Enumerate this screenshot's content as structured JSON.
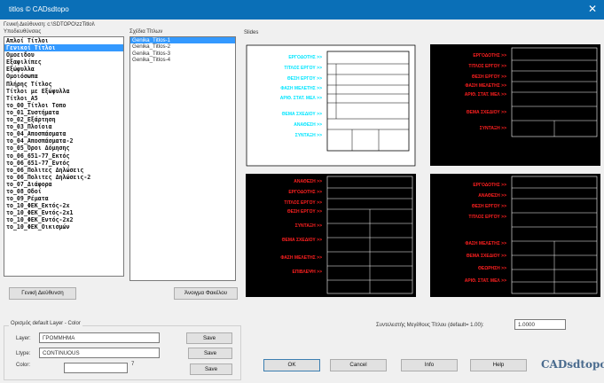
{
  "window": {
    "title": "titlos  © CADsdtopo",
    "close_glyph": "✕"
  },
  "path": {
    "label": "Γενική Διεύθυνση: c:\\SDTOPO\\zzTitloi\\"
  },
  "folders": {
    "label": "Υποδιευθύνσεις",
    "items": [
      "Απλοί Τίτλοι",
      "Γενικοί Τίτλοι",
      "Ομοειδου",
      "Εξαφιλίπες",
      "Εξώφυλλα",
      "Ομοιόσωπα",
      "Πλήρης Τίτλος",
      "Τίτλοι με Εξώφυλλα",
      "Τίτλοι_Α5",
      "το_00_Τίτλοι Τοπο",
      "το_01_Συστήματα",
      "το_02_Εξάρτηση",
      "το_03_Πλοίοια",
      "το_04_Αποσπάσματα",
      "το_04_Αποσπάσματα-2",
      "το_05_Όροι Δόμησης",
      "το_06_651-77_Εκτός",
      "το_06_651-77_Εντός",
      "το_06_Πολιτες Δηλώσεις",
      "το_06_Πολιτες Δηλώσεις-2",
      "το_07_Διάφορα",
      "το_08_Οδοί",
      "το_09_Ρέματα",
      "το_10_ΦΕΚ_Εκτός-2x",
      "το_10_ΦΕΚ_Εντός-2x1",
      "το_10_ΦΕΚ_Εντός-2x2",
      "το_10_ΦΕΚ_Οικισμών"
    ],
    "selected_index": 1
  },
  "templates": {
    "label": "Σχέδια Τίτλων",
    "items": [
      "Genika_Titlos-1",
      "Genika_Titlos-2",
      "Genika_Titlos-3",
      "Genika_Titlos-4"
    ],
    "selected_index": 0
  },
  "slides": {
    "label": "Slides"
  },
  "buttons": {
    "general_address": "Γενική Διεύθυνση",
    "open_folder": "Άνοιγμα Φακέλου",
    "save1": "Save",
    "save2": "Save",
    "save3": "Save",
    "ok": "OK",
    "cancel": "Cancel",
    "info": "Info",
    "help": "Help"
  },
  "defaults_group": {
    "label": "Ορισμός default Layer - Color",
    "layer_label": "Layer:",
    "layer_value": "ΓΡΟΜΜΗΜΑ",
    "ltype_label": "Ltype:",
    "ltype_value": "CONTINUOUS",
    "color_label": "Color:",
    "color_value": "",
    "color_hint": "7"
  },
  "scale": {
    "label": "Συντελεστής Μεγέθους Τίτλου (default= 1.00):",
    "value": "1.0000"
  },
  "logo": {
    "text": "CADsdtopo"
  },
  "slide_text": {
    "s1": {
      "labels": [
        "ΕΡΓΟΔΟΤΗΣ >>",
        "ΤΙΤΛΟΣ ΕΡΓΟΥ >>",
        "ΘΕΣΗ ΕΡΓΟΥ >>",
        "ΦΑΣΗ ΜΕΛΕΤΗΣ >>",
        "ΑΡΙΘ. ΣΤΑΤ. ΜΕΛ >>",
        "ΘΕΜΑ ΣΧΕΔΙΟΥ >>",
        "ΑΝΑΘΕΣΗ >>",
        "ΣΥΝΤΑΞΗ >>"
      ]
    },
    "s2": {
      "labels": [
        "ΕΡΓΟΔΟΤΗΣ >>",
        "ΤΙΤΛΟΣ ΕΡΓΟΥ >>",
        "ΘΕΣΗ ΕΡΓΟΥ >>",
        "ΦΑΣΗ ΜΕΛΕΤΗΣ >>",
        "ΑΡΙΘ. ΣΤΑΤ. ΜΕΛ >>",
        "ΘΕΜΑ ΣΧΕΔΙΟΥ >>",
        "ΣΥΝΤΑΞΗ >>"
      ]
    },
    "s3": {
      "labels": [
        "ΑΝΑΘΕΣΗ >>",
        "ΕΡΓΟΔΟΤΗΣ >>",
        "ΤΙΤΛΟΣ ΕΡΓΟΥ >>",
        "ΘΕΣΗ ΕΡΓΟΥ >>",
        "ΣΥΝΤΑΞΗ >>",
        "ΘΕΜΑ ΣΧΕΔΙΟΥ >>",
        "ΦΑΣΗ ΜΕΛΕΤΗΣ >>",
        "ΕΠΙΒΛΕΨΗ >>"
      ]
    },
    "s4": {
      "labels": [
        "ΕΡΓΟΔΟΤΗΣ >>",
        "ΑΝΑΘΕΣΗ >>",
        "ΘΕΣΗ ΕΡΓΟΥ >>",
        "ΤΙΤΛΟΣ ΕΡΓΟΥ >>",
        "ΦΑΣΗ ΜΕΛΕΤΗΣ >>",
        "ΘΕΜΑ ΣΧΕΔΙΟΥ >>",
        "ΘΕΩΡΗΣΗ >>",
        "ΑΡΙΘ. ΣΤΑΤ. ΜΕΛ >>"
      ]
    }
  },
  "colors": {
    "title_bar": "#0a6fb7",
    "selection": "#3399ff",
    "slide_cyan": "#00e5ff",
    "slide_red": "#ff2020",
    "slide_black": "#000000"
  }
}
